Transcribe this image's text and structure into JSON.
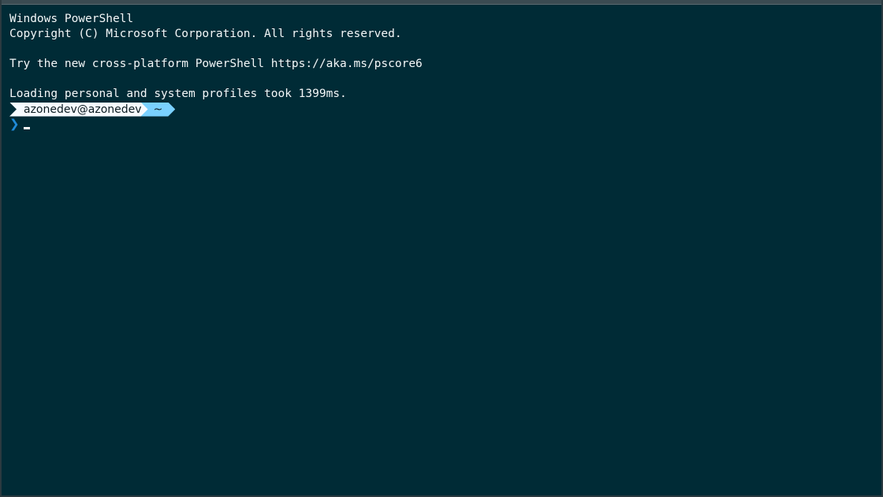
{
  "terminal": {
    "lines": [
      "Windows PowerShell",
      "Copyright (C) Microsoft Corporation. All rights reserved.",
      "",
      "Try the new cross-platform PowerShell https://aka.ms/pscore6",
      "",
      "Loading personal and system profiles took 1399ms."
    ],
    "prompt": {
      "user_host": "azonedev@azonedev",
      "path": "~",
      "symbol": "❯"
    }
  },
  "colors": {
    "background": "#002b36",
    "text": "#f4f7f8",
    "segment_user_bg": "#f7fbff",
    "segment_path_bg": "#7ad1ff",
    "prompt_symbol": "#1f8ad8"
  }
}
